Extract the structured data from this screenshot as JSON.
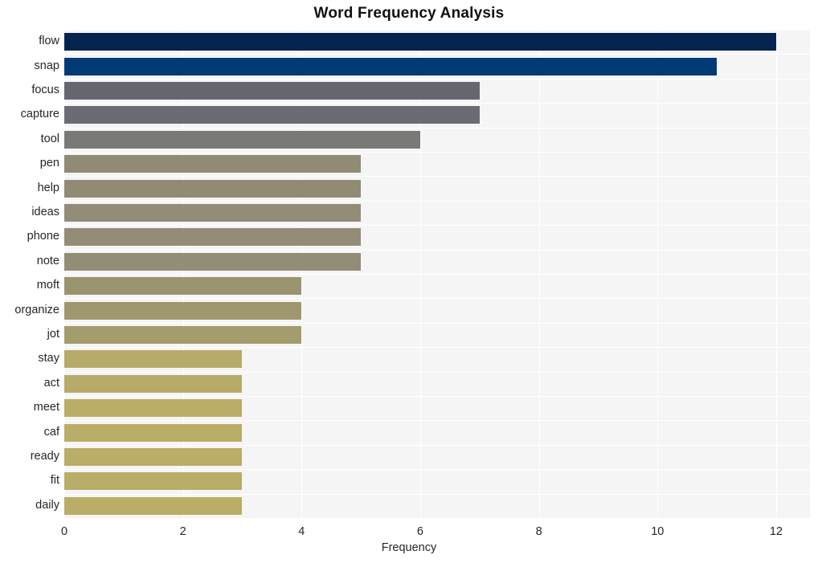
{
  "chart_data": {
    "type": "bar",
    "orientation": "horizontal",
    "title": "Word Frequency Analysis",
    "xlabel": "Frequency",
    "ylabel": "",
    "xlim": [
      0,
      12.57
    ],
    "xticks": [
      0,
      2,
      4,
      6,
      8,
      10,
      12
    ],
    "xtick_labels": [
      "0",
      "2",
      "4",
      "6",
      "8",
      "10",
      "12"
    ],
    "grid": true,
    "legend": "none",
    "categories": [
      "flow",
      "snap",
      "focus",
      "capture",
      "tool",
      "pen",
      "help",
      "ideas",
      "phone",
      "note",
      "moft",
      "organize",
      "jot",
      "stay",
      "act",
      "meet",
      "caf",
      "ready",
      "fit",
      "daily"
    ],
    "values": [
      12,
      11,
      7,
      7,
      6,
      5,
      5,
      5,
      5,
      5,
      4,
      4,
      4,
      3,
      3,
      3,
      3,
      3,
      3,
      3
    ],
    "bar_colors": [
      "#04244f",
      "#013a74",
      "#66676e",
      "#6b6c73",
      "#797a78",
      "#918b75",
      "#918b75",
      "#938d77",
      "#938d77",
      "#938d77",
      "#9b9470",
      "#9f986e",
      "#a39c6c",
      "#b7ab69",
      "#b7ab69",
      "#b9ad67",
      "#b9ad67",
      "#b9ad67",
      "#b9ad67",
      "#b9ad67"
    ]
  },
  "style": {
    "plot_background": "#f5f5f6",
    "page_background": "#ffffff",
    "gridline_color": "#ffffff",
    "text_color": "#262626",
    "title_color": "#111111"
  }
}
